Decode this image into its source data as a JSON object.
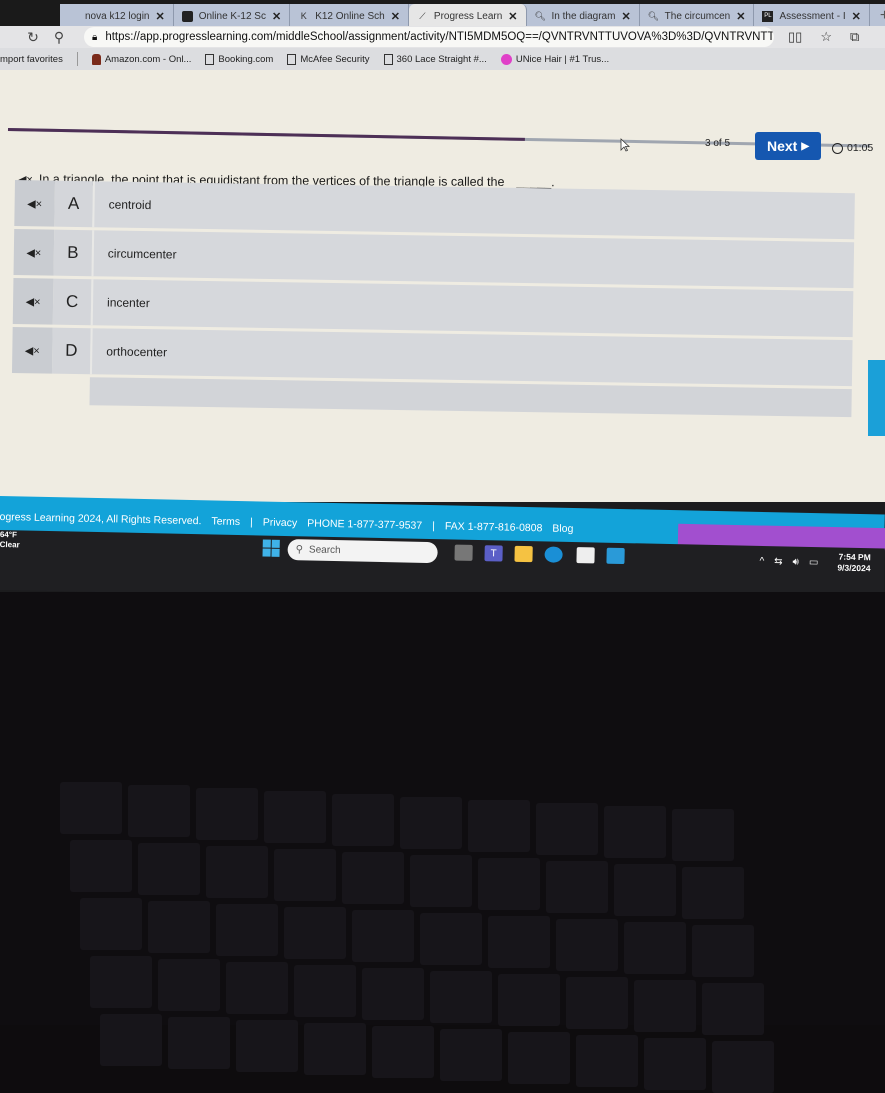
{
  "browser": {
    "tabs": [
      {
        "label": "nova k12 login",
        "icon": "page-icon",
        "active": false
      },
      {
        "label": "Online K-12 Sc",
        "icon": "folder-icon",
        "active": false
      },
      {
        "label": "K12 Online Sch",
        "icon": "k12-icon",
        "active": false
      },
      {
        "label": "Progress Learn",
        "icon": "progress-learning-icon",
        "active": true
      },
      {
        "label": "In the diagram",
        "icon": "search-icon",
        "active": false
      },
      {
        "label": "The circumcen",
        "icon": "search-icon",
        "active": false
      },
      {
        "label": "Assessment - I",
        "icon": "assessment-icon",
        "active": false
      }
    ],
    "new_tab_label": "+",
    "close_glyph": "✕",
    "url": "https://app.progresslearning.com/middleSchool/assignment/activity/NTI5MDM5OQ==/QVNTRVNTTUVOVA%3D%3D/QVNTRVNTTUVOV...",
    "favorites": [
      {
        "label": "mport favorites",
        "icon": "none"
      },
      {
        "label": "Amazon.com - Onl...",
        "icon": "amazon-icon"
      },
      {
        "label": "Booking.com",
        "icon": "document-icon"
      },
      {
        "label": "McAfee Security",
        "icon": "document-icon"
      },
      {
        "label": "360 Lace Straight #...",
        "icon": "document-icon"
      },
      {
        "label": "UNice Hair | #1 Trus...",
        "icon": "unice-icon"
      }
    ]
  },
  "activity": {
    "progress_fraction": 0.6,
    "counter": "3 of 5",
    "next_label": "Next",
    "timer": "01:05",
    "question": "In a triangle, the point that is equidistant from the vertices of the triangle is called the",
    "blank": "_____.",
    "answers": [
      {
        "letter": "A",
        "text": "centroid"
      },
      {
        "letter": "B",
        "text": "circumcenter"
      },
      {
        "letter": "C",
        "text": "incenter"
      },
      {
        "letter": "D",
        "text": "orthocenter"
      }
    ]
  },
  "footer": {
    "copyright": "ogress Learning 2024, All Rights Reserved.",
    "terms": "Terms",
    "privacy": "Privacy",
    "phone": "PHONE 1-877-377-9537",
    "fax": "FAX 1-877-816-0808",
    "blog": "Blog",
    "pipe": "|"
  },
  "taskbar": {
    "weather_temp": "64°F",
    "weather_desc": "Clear",
    "search_placeholder": "Search",
    "time": "7:54 PM",
    "date": "9/3/2024",
    "apps": [
      "task-view",
      "teams",
      "file-explorer",
      "edge",
      "microsoft-store",
      "app"
    ]
  },
  "colors": {
    "next_button": "#1557b0",
    "footer": "#13a3d9",
    "progress_fill": "#4d2f56"
  }
}
